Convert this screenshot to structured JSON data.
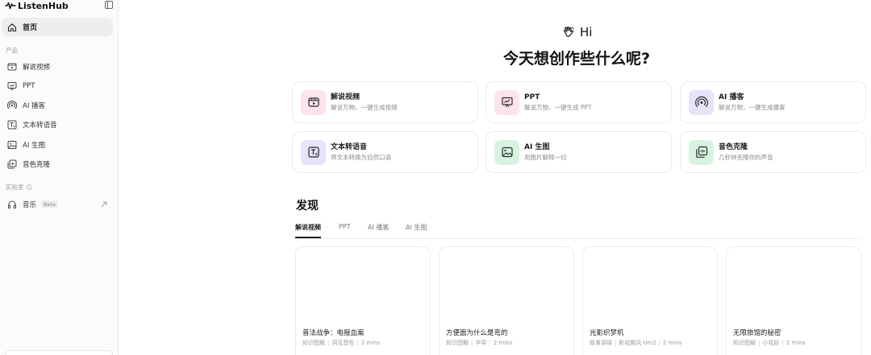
{
  "sidebar": {
    "brand": "ListenHub",
    "home_label": "首页",
    "section_products": "产品",
    "products": [
      {
        "label": "解说视频",
        "icon": "video-icon"
      },
      {
        "label": "PPT",
        "icon": "presentation-icon"
      },
      {
        "label": "AI 播客",
        "icon": "podcast-icon"
      },
      {
        "label": "文本转语音",
        "icon": "text-to-speech-icon"
      },
      {
        "label": "AI 生图",
        "icon": "image-icon"
      },
      {
        "label": "音色克隆",
        "icon": "voice-clone-icon"
      }
    ],
    "section_lab": "实验室",
    "lab_items": [
      {
        "label": "音乐",
        "badge": "Beta",
        "icon": "headphones-icon"
      }
    ]
  },
  "hero": {
    "greeting": "Hi",
    "title": "今天想创作些什么呢?"
  },
  "features": [
    {
      "title": "解说视频",
      "desc": "解说万物，一键生成视频",
      "icon": "video-icon",
      "tile_color": "#fde3ec"
    },
    {
      "title": "PPT",
      "desc": "解说万物，一键生成 PPT",
      "icon": "presentation-icon",
      "tile_color": "#fde3ec"
    },
    {
      "title": "AI 播客",
      "desc": "解说万物，一键生成播客",
      "icon": "podcast-icon",
      "tile_color": "#e6e3fb"
    },
    {
      "title": "文本转语音",
      "desc": "将文本转换为自然口语",
      "icon": "text-to-speech-icon",
      "tile_color": "#e6e3fb"
    },
    {
      "title": "AI 生图",
      "desc": "用图片解释一切",
      "icon": "image-icon",
      "tile_color": "#d8f3e2"
    },
    {
      "title": "音色克隆",
      "desc": "几秒钟克隆你的声音",
      "icon": "voice-clone-icon",
      "tile_color": "#d8f3e2"
    }
  ],
  "discover": {
    "title": "发现",
    "tabs": [
      "解说视频",
      "PPT",
      "AI 播客",
      "AI 生图"
    ],
    "active_tab": "解说视频",
    "videos": [
      {
        "title": "普法战争：电报血案",
        "tag": "知识图解",
        "voice": "洞见音色",
        "duration": "2 mins"
      },
      {
        "title": "方便面为什么是弯的",
        "tag": "知识图解",
        "voice": "华导",
        "duration": "2 mins"
      },
      {
        "title": "光影织梦机",
        "tag": "故事讲绎",
        "voice": "影视飓风 tim2",
        "duration": "2 mins"
      },
      {
        "title": "无限旅馆的秘密",
        "tag": "知识图解",
        "voice": "小花妖",
        "duration": "2 mins"
      }
    ]
  }
}
